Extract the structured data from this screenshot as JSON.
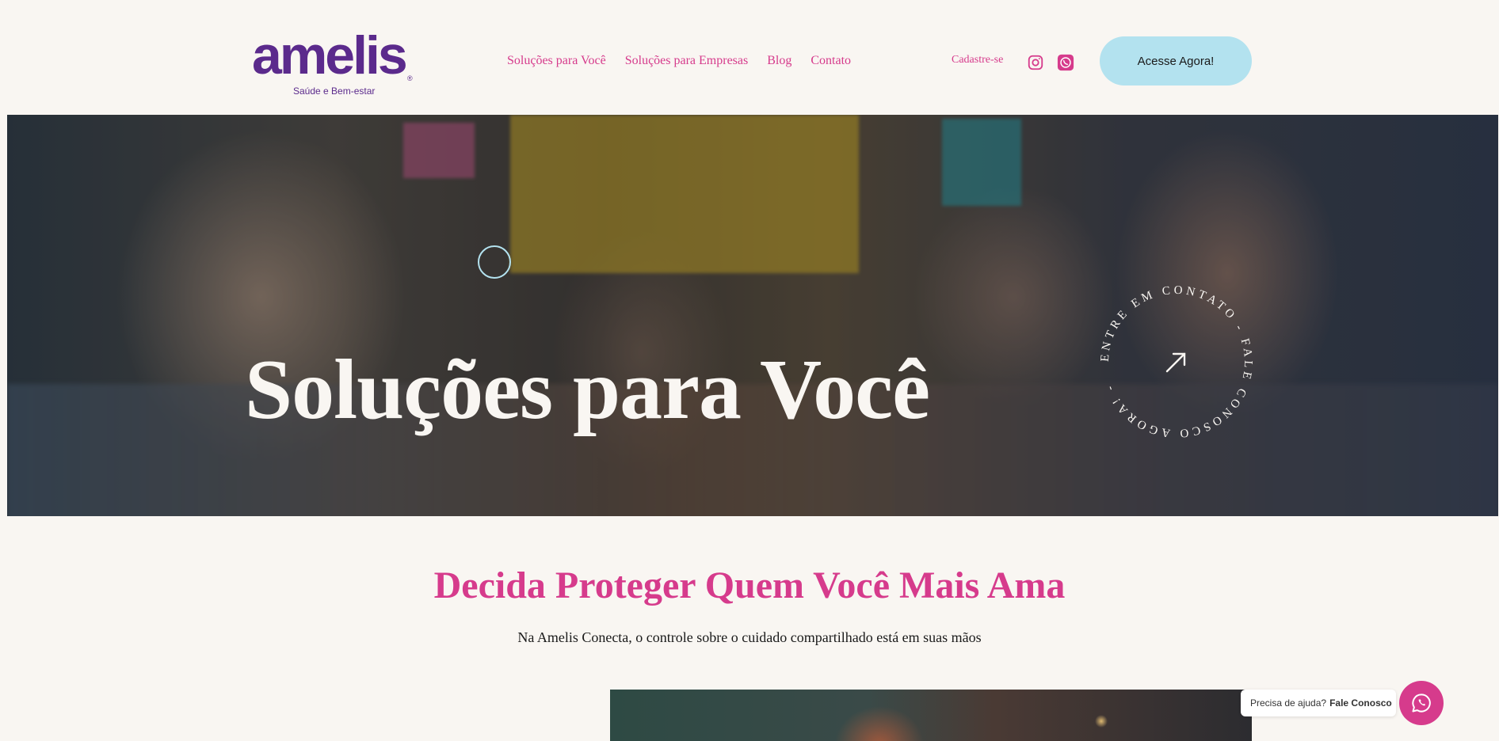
{
  "header": {
    "logo": {
      "word": "amelis",
      "registered": "®",
      "tagline": "Saúde e Bem-estar"
    },
    "nav": [
      {
        "label": "Soluções para Você"
      },
      {
        "label": "Soluções para Empresas"
      },
      {
        "label": "Blog"
      },
      {
        "label": "Contato"
      }
    ],
    "signup_label": "Cadastre-se",
    "social": {
      "instagram": "instagram-icon",
      "whatsapp": "whatsapp-icon"
    },
    "cta_label": "Acesse Agora!"
  },
  "hero": {
    "title": "Soluções para Você",
    "badge_text": "ENTRE EM CONTATO - FALE CONOSCO AGORA! - ",
    "badge_icon": "arrow-up-right-icon"
  },
  "section": {
    "title": "Decida Proteger Quem Você Mais Ama",
    "subtitle": "Na Amelis Conecta, o controle sobre o cuidado compartilhado está em suas mãos"
  },
  "help": {
    "prefix": "Precisa de ajuda?",
    "link": "Fale Conosco",
    "icon": "whatsapp-icon"
  },
  "colors": {
    "brand_purple": "#5b2a8c",
    "accent_pink": "#d63b8c",
    "cta_blue": "#b3e2ef",
    "background": "#f9f6f2"
  }
}
